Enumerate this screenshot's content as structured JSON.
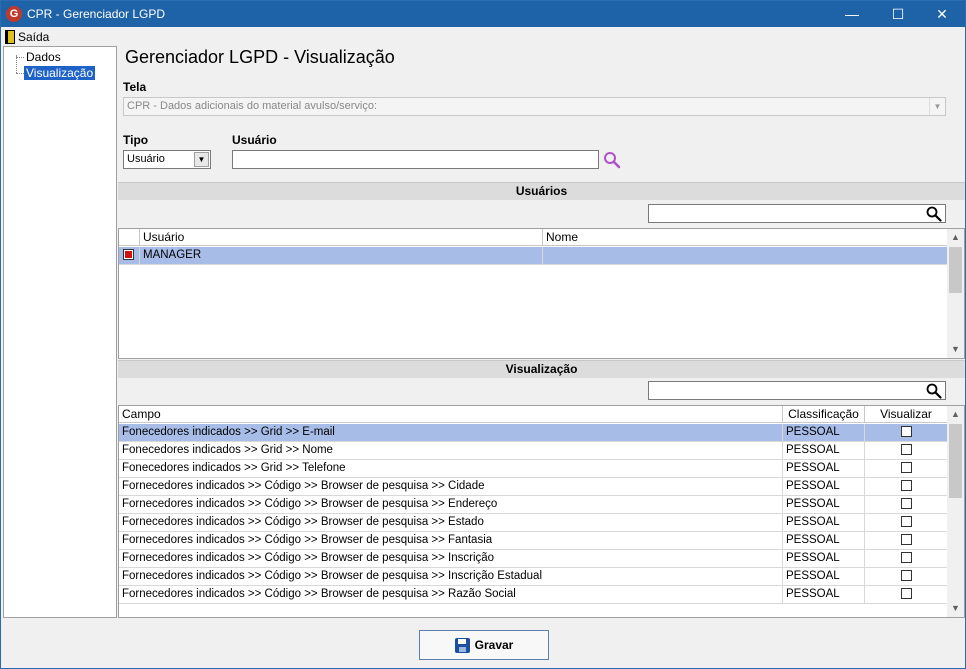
{
  "window": {
    "title": "CPR - Gerenciador LGPD",
    "min": "—",
    "max": "☐",
    "close": "✕",
    "app_icon": "G"
  },
  "menu": {
    "exit_label": "Saída"
  },
  "tree": {
    "items": [
      {
        "label": "Dados"
      },
      {
        "label": "Visualização",
        "selected": true
      }
    ]
  },
  "page_title": "Gerenciador LGPD - Visualização",
  "tela": {
    "label": "Tela",
    "value": "CPR - Dados adicionais do material avulso/serviço:"
  },
  "tipo": {
    "label": "Tipo",
    "value": "Usuário"
  },
  "usuario": {
    "label": "Usuário",
    "value": ""
  },
  "usuarios_section": {
    "title": "Usuários",
    "columns": [
      "Usuário",
      "Nome"
    ],
    "rows": [
      {
        "checked": true,
        "usuario": "MANAGER",
        "nome": ""
      }
    ]
  },
  "visualizacao_section": {
    "title": "Visualização",
    "columns": [
      "Campo",
      "Classificação",
      "Visualizar"
    ],
    "rows": [
      {
        "campo": "Fonecedores indicados >> Grid >> E-mail",
        "classificacao": "PESSOAL",
        "visualizar": false
      },
      {
        "campo": "Fonecedores indicados >> Grid >> Nome",
        "classificacao": "PESSOAL",
        "visualizar": false
      },
      {
        "campo": "Fonecedores indicados >> Grid >> Telefone",
        "classificacao": "PESSOAL",
        "visualizar": false
      },
      {
        "campo": "Fornecedores indicados >> Código >> Browser de pesquisa >> Cidade",
        "classificacao": "PESSOAL",
        "visualizar": false
      },
      {
        "campo": "Fornecedores indicados >> Código >> Browser de pesquisa >> Endereço",
        "classificacao": "PESSOAL",
        "visualizar": false
      },
      {
        "campo": "Fornecedores indicados >> Código >> Browser de pesquisa >> Estado",
        "classificacao": "PESSOAL",
        "visualizar": false
      },
      {
        "campo": "Fornecedores indicados >> Código >> Browser de pesquisa >> Fantasia",
        "classificacao": "PESSOAL",
        "visualizar": false
      },
      {
        "campo": "Fornecedores indicados >> Código >> Browser de pesquisa >> Inscrição",
        "classificacao": "PESSOAL",
        "visualizar": false
      },
      {
        "campo": "Fornecedores indicados >> Código >> Browser de pesquisa >> Inscrição Estadual",
        "classificacao": "PESSOAL",
        "visualizar": false
      },
      {
        "campo": "Fornecedores indicados >> Código >> Browser de pesquisa >> Razão Social",
        "classificacao": "PESSOAL",
        "visualizar": false
      }
    ]
  },
  "buttons": {
    "save_label": "Gravar"
  },
  "colors": {
    "titlebar": "#1e62a8",
    "selection": "#a7bde8",
    "tree_selection": "#1e62c8"
  }
}
